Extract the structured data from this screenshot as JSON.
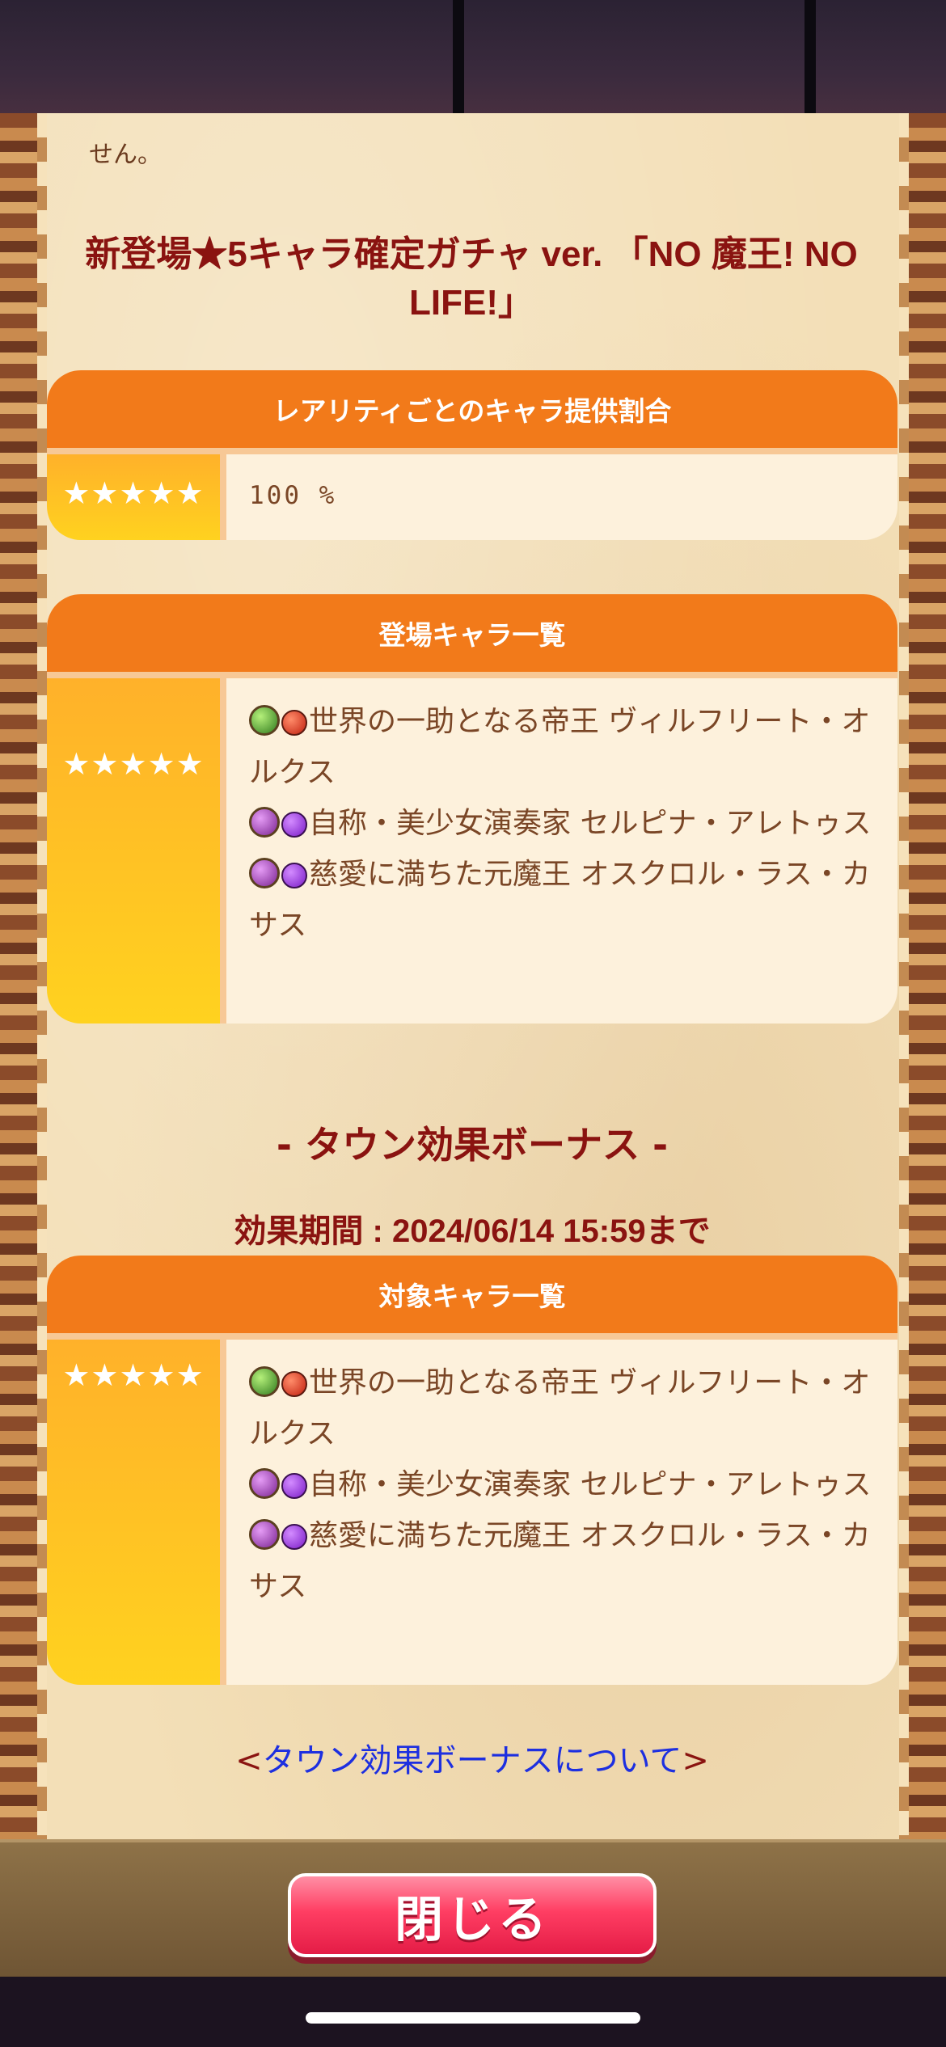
{
  "intro_text": "せん。",
  "gacha_title": "新登場★5キャラ確定ガチャ ver. 「NO 魔王! NO LIFE!」",
  "rarity_section": {
    "header": "レアリティごとのキャラ提供割合",
    "rarity_label": "★★★★★",
    "rate": "100 %"
  },
  "characters_section": {
    "header": "登場キャラ一覧",
    "rarity_label": "★★★★★",
    "characters": [
      {
        "name": "世界の一助となる帝王 ヴィルフリート・オルクス",
        "weapon_icon": "green-weapon-icon",
        "element_icon": "fire-element-icon"
      },
      {
        "name": "自称・美少女演奏家 セルピナ・アレトゥス",
        "weapon_icon": "purple-weapon-icon",
        "element_icon": "dark-element-icon"
      },
      {
        "name": "慈愛に満ちた元魔王 オスクロル・ラス・カサス",
        "weapon_icon": "purple-weapon-icon",
        "element_icon": "dark-element-icon"
      }
    ]
  },
  "town_bonus": {
    "title": "- タウン効果ボーナス -",
    "period": "効果期間 : 2024/06/14 15:59まで",
    "header": "対象キャラ一覧",
    "rarity_label": "★★★★★",
    "characters": [
      {
        "name": "世界の一助となる帝王 ヴィルフリート・オルクス"
      },
      {
        "name": "自称・美少女演奏家 セルピナ・アレトゥス"
      },
      {
        "name": "慈愛に満ちた元魔王 オスクロル・ラス・カサス"
      }
    ],
    "link_open": "<",
    "link_text": "タウン効果ボーナスについて",
    "link_close": ">"
  },
  "close_button": "閉じる",
  "colors": {
    "header_orange": "#f27a1a",
    "title_red": "#8a1310",
    "link_blue": "#1d2fe0",
    "close_pink": "#ff3e63"
  }
}
